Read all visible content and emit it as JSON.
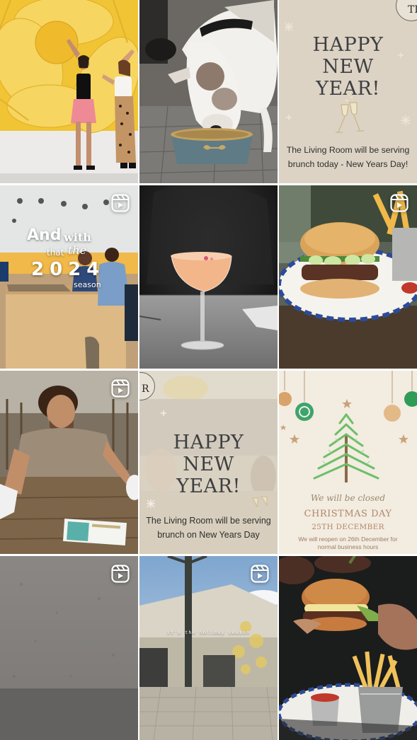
{
  "grid": {
    "tiles": [
      {
        "name": "post-sunflower-mural",
        "reel": false
      },
      {
        "name": "post-dog-bowl",
        "reel": false
      },
      {
        "name": "post-happy-new-year-brunch-today",
        "reel": false
      },
      {
        "name": "post-and-with-that-2024-season",
        "reel": true
      },
      {
        "name": "post-cocktail-glass",
        "reel": false
      },
      {
        "name": "post-burger-plate",
        "reel": true
      },
      {
        "name": "post-man-at-table",
        "reel": true
      },
      {
        "name": "post-happy-new-year-brunch",
        "reel": false
      },
      {
        "name": "post-christmas-closed",
        "reel": false
      },
      {
        "name": "post-wall-texture",
        "reel": true
      },
      {
        "name": "post-holiday-season-street",
        "reel": true
      },
      {
        "name": "post-burger-fries",
        "reel": false
      }
    ]
  },
  "posts": {
    "new_year_today": {
      "title_line1": "HAPPY",
      "title_line2": "NEW",
      "title_line3": "YEAR!",
      "sub_line1": "The Living Room will be serving",
      "sub_line2": "brunch today - New Years Day!"
    },
    "reel_2024": {
      "and": "And",
      "with": "with",
      "that": "that",
      "the": "the",
      "year": "2024",
      "season": "season"
    },
    "new_year": {
      "title_line1": "HAPPY",
      "title_line2": "NEW",
      "title_line3": "YEAR!",
      "sub_line1": "The Living Room will be serving",
      "sub_line2": "brunch on New Years Day"
    },
    "christmas": {
      "closed": "We will be closed",
      "day": "CHRISTMAS DAY",
      "date": "25TH DECEMBER",
      "note_line1": "We will reopen on 26th December for",
      "note_line2": "normal business hours"
    },
    "holiday_caption": "it's the holiday season"
  },
  "icons": {
    "reel": "reel-icon",
    "logo": "tlr-logo-icon"
  },
  "colors": {
    "poster_bg": "#dcd3c4",
    "poster_text": "#3e3f42",
    "xmas_bg": "#f3ece0",
    "xmas_tree": "#6bbf6a",
    "xmas_text": "#b0876a",
    "sunflower": "#f1c93c"
  }
}
